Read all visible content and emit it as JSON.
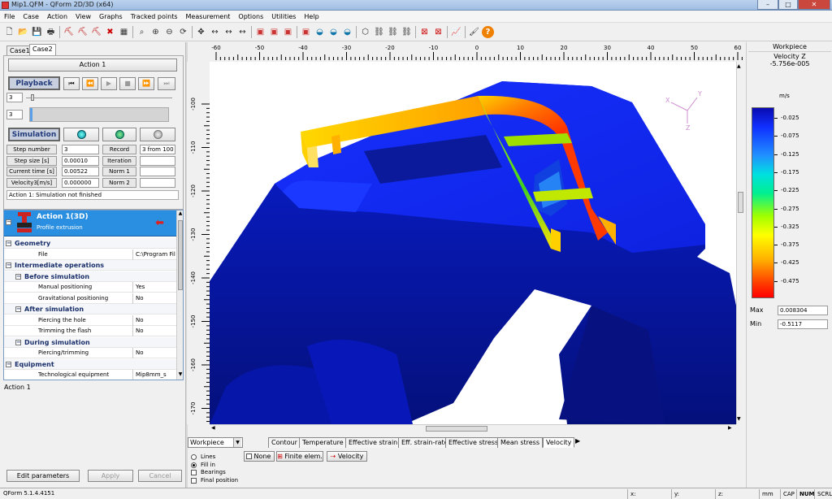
{
  "window": {
    "title": "Mip1.QFM - QForm 2D/3D (x64)",
    "min": "–",
    "max": "□",
    "close": "✕"
  },
  "menu": [
    "File",
    "Case",
    "Action",
    "View",
    "Graphs",
    "Tracked points",
    "Measurement",
    "Options",
    "Utilities",
    "Help"
  ],
  "toolbar_icons": [
    "new-icon",
    "open-icon",
    "save-icon",
    "print-icon",
    "tool-icon",
    "tool-icon",
    "tool-icon",
    "delete-icon",
    "table-icon",
    "zoom-fit-icon",
    "zoom-in-icon",
    "zoom-out-icon",
    "rotate-icon",
    "pan-icon",
    "measure-icon",
    "measure-icon",
    "measure-icon",
    "color-icon",
    "color-icon",
    "color-icon",
    "color-icon",
    "section-icon",
    "section-icon",
    "section-icon",
    "shape-icon",
    "link-icon",
    "link-icon",
    "link-icon",
    "close-icon",
    "close-icon",
    "chart-icon",
    "brush-icon",
    "help-icon"
  ],
  "cases": {
    "tabs": [
      "Case1",
      "Case2"
    ],
    "active": 1
  },
  "action_label": "Action 1",
  "playback": {
    "label": "Playback",
    "field1": "3",
    "field2": "3"
  },
  "simulation": {
    "label": "Simulation",
    "rows": [
      {
        "label": "Step number",
        "value": "3",
        "label2": "Record",
        "value2": "3 from 100"
      },
      {
        "label": "Step size [s]",
        "value": "0.00010",
        "label2": "Iteration",
        "value2": ""
      },
      {
        "label": "Current time [s]",
        "value": "0.00522",
        "label2": "Norm 1",
        "value2": ""
      },
      {
        "label": "Velocity3[m/s]",
        "value": "0.000000",
        "label2": "Norm 2",
        "value2": ""
      }
    ],
    "status": "Action 1: Simulation not finished"
  },
  "action_header": {
    "title": "Action 1(3D)",
    "subtitle": "Profile extrusion"
  },
  "tree": [
    {
      "label": "Geometry",
      "level": 0,
      "group": true,
      "expander": "−"
    },
    {
      "label": "File",
      "level": 2,
      "value": "C:\\Program Fil"
    },
    {
      "label": "Intermediate operations",
      "level": 0,
      "group": true,
      "expander": "−"
    },
    {
      "label": "Before simulation",
      "level": 1,
      "group": true,
      "expander": "−"
    },
    {
      "label": "Manual positioning",
      "level": 2,
      "value": "Yes"
    },
    {
      "label": "Gravitational positioning",
      "level": 2,
      "value": "No"
    },
    {
      "label": "After simulation",
      "level": 1,
      "group": true,
      "expander": "−"
    },
    {
      "label": "Piercing the hole",
      "level": 2,
      "value": "No"
    },
    {
      "label": "Trimming the flash",
      "level": 2,
      "value": "No"
    },
    {
      "label": "During simulation",
      "level": 1,
      "group": true,
      "expander": "−"
    },
    {
      "label": "Piercing/trimming",
      "level": 2,
      "value": "No"
    },
    {
      "label": "Equipment",
      "level": 0,
      "group": true,
      "expander": "−"
    },
    {
      "label": "Technological equipment",
      "level": 2,
      "value": "Mip8mm_s"
    }
  ],
  "tree_footer": "Action 1",
  "left_buttons": {
    "edit": "Edit parameters",
    "apply": "Apply",
    "cancel": "Cancel"
  },
  "ruler_top": [
    "-60",
    "-50",
    "-40",
    "-30",
    "-20",
    "-10",
    "0",
    "10",
    "20",
    "30",
    "40",
    "50",
    "60"
  ],
  "ruler_left": [
    "-100",
    "-110",
    "-120",
    "-130",
    "-140",
    "-150",
    "-160",
    "-170"
  ],
  "axes": {
    "x": "X",
    "y": "Y",
    "z": "Z"
  },
  "legend": {
    "title": "Workpiece",
    "quantity": "Velocity Z",
    "value": "-5.756e-005",
    "unit": "m/s",
    "ticks": [
      "-0.025",
      "-0.075",
      "-0.125",
      "-0.175",
      "-0.225",
      "-0.275",
      "-0.325",
      "-0.375",
      "-0.425",
      "-0.475"
    ],
    "max_label": "Max",
    "max": "0.008304",
    "min_label": "Min",
    "min": "-0.5117"
  },
  "object_select": "Workpiece",
  "result_tabs": [
    "Contour",
    "Temperature",
    "Effective strain",
    "Eff. strain-rate",
    "Effective stress",
    "Mean stress",
    "Velocity"
  ],
  "display_options": [
    "None",
    "Finite elem.",
    "Velocity"
  ],
  "render_modes": [
    {
      "label": "Lines",
      "type": "radio",
      "checked": false
    },
    {
      "label": "Fill in",
      "type": "radio",
      "checked": true
    },
    {
      "label": "Bearings",
      "type": "check",
      "checked": false
    },
    {
      "label": "Final position",
      "type": "check",
      "checked": false
    }
  ],
  "status": {
    "version": "QForm 5.1.4.4151",
    "x": "x:",
    "y": "y:",
    "z": "z:",
    "unit": "mm",
    "cap": "CAP",
    "num": "NUM",
    "scrl": "SCRL"
  }
}
